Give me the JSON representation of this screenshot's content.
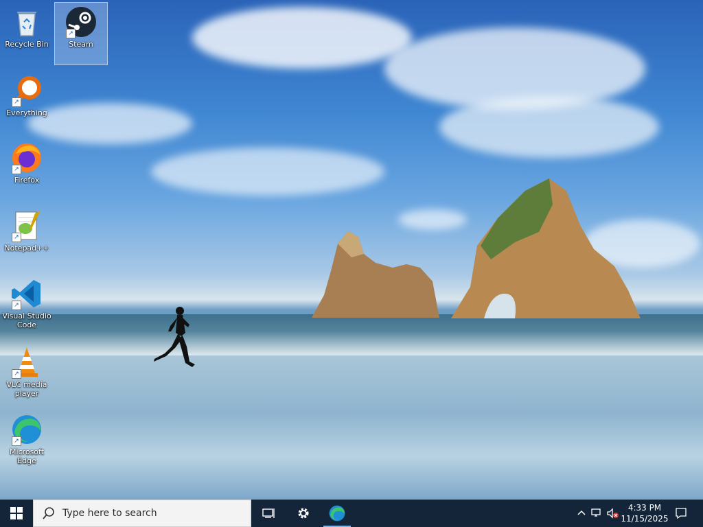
{
  "desktop_icons": [
    {
      "name": "recycle-bin",
      "label": "Recycle Bin",
      "icon": "recycle-bin-icon"
    },
    {
      "name": "steam",
      "label": "Steam",
      "icon": "steam-icon"
    },
    {
      "name": "everything",
      "label": "Everything",
      "icon": "magnifier-icon"
    },
    {
      "name": "firefox",
      "label": "Firefox",
      "icon": "firefox-icon"
    },
    {
      "name": "notepadpp",
      "label": "Notepad++",
      "icon": "notepadpp-icon"
    },
    {
      "name": "vscode",
      "label": "Visual Studio Code",
      "icon": "vscode-icon"
    },
    {
      "name": "vlc",
      "label": "VLC media player",
      "icon": "vlc-cone-icon"
    },
    {
      "name": "edge",
      "label": "Microsoft Edge",
      "icon": "edge-icon"
    }
  ],
  "taskbar": {
    "search_placeholder": "Type here to search",
    "pinned": [
      {
        "name": "task-view",
        "icon": "task-view-icon"
      },
      {
        "name": "settings",
        "icon": "gear-icon"
      },
      {
        "name": "edge",
        "icon": "edge-icon",
        "active": true
      }
    ],
    "tray": {
      "time": "4:33 PM",
      "date": "11/15/2025"
    }
  },
  "colors": {
    "taskbar_bg": "#14253a",
    "search_bg": "#f3f3f3",
    "accent": "#7fb2e8"
  }
}
